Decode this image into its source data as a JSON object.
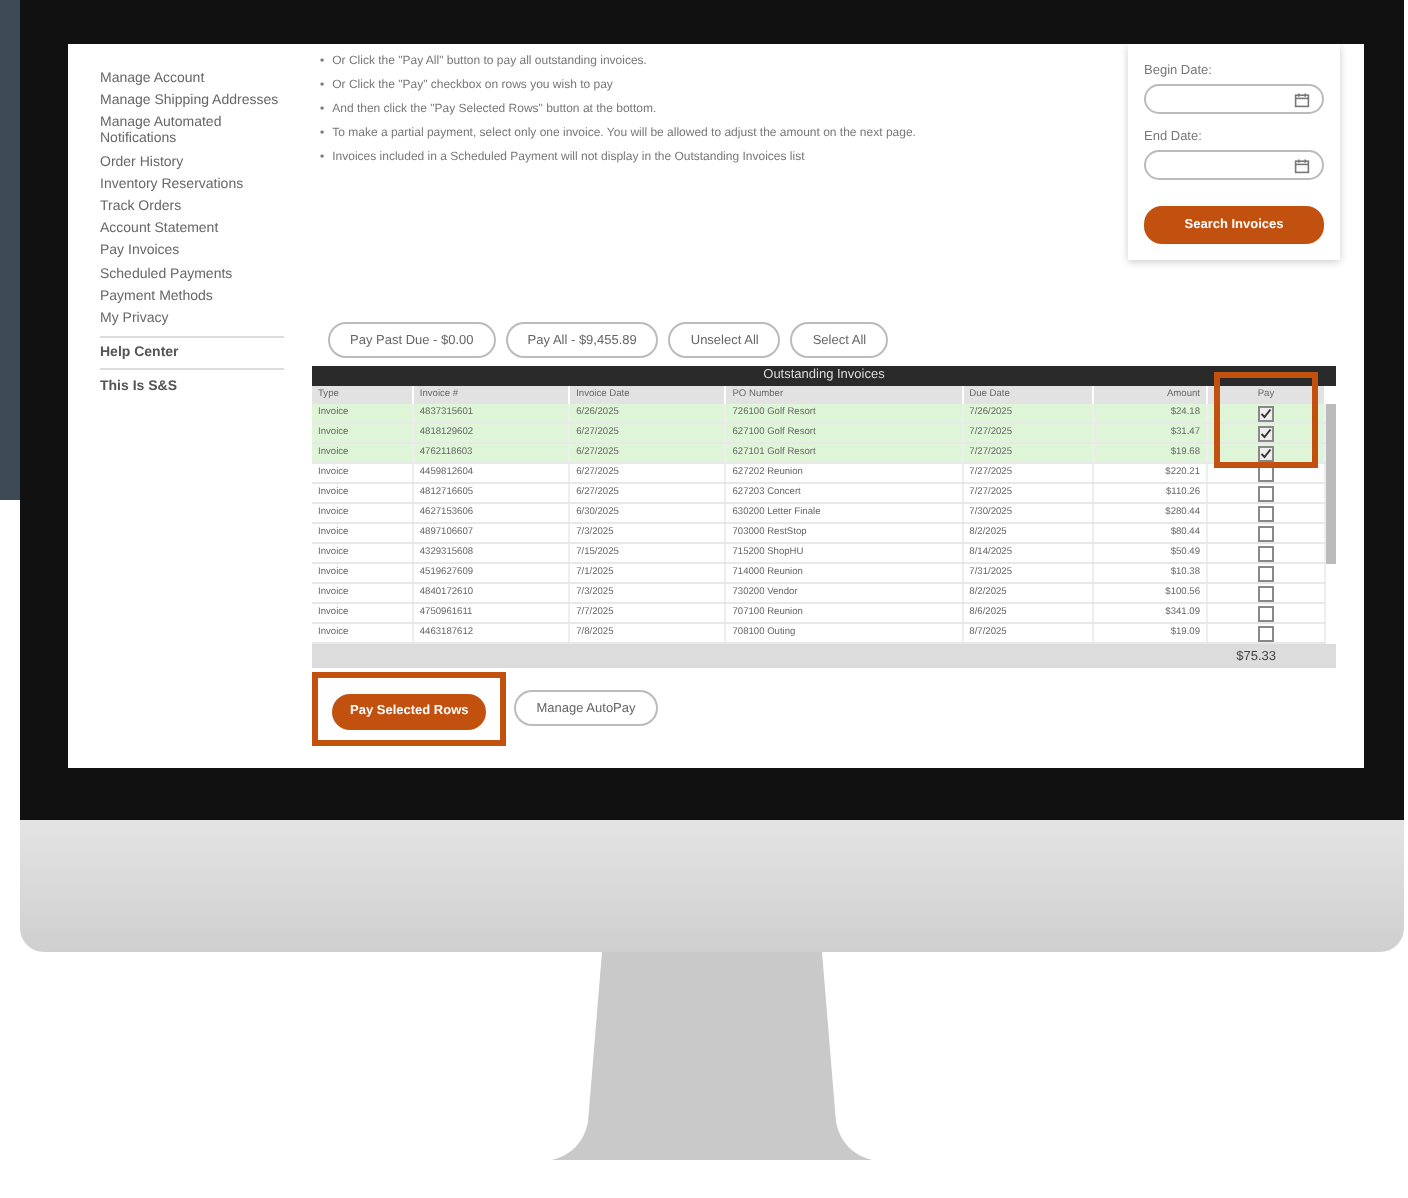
{
  "sidebar": {
    "items": [
      {
        "label": "Manage Account"
      },
      {
        "label": "Manage Shipping Addresses"
      },
      {
        "label": "Manage Automated Notifications"
      },
      {
        "label": "Order History"
      },
      {
        "label": "Inventory Reservations"
      },
      {
        "label": "Track Orders"
      },
      {
        "label": "Account Statement"
      },
      {
        "label": "Pay Invoices"
      },
      {
        "label": "Scheduled Payments"
      },
      {
        "label": "Payment Methods"
      },
      {
        "label": "My Privacy"
      }
    ],
    "sections": [
      "Help Center",
      "This Is S&S"
    ]
  },
  "instructions": [
    {
      "bullet": "•",
      "text": "Or Click the \"Pay All\" button to pay all outstanding invoices."
    },
    {
      "bullet": "•",
      "text": "Or Click the \"Pay\" checkbox on rows you wish to pay"
    },
    {
      "bullet": "•",
      "text": "And then click the \"Pay Selected Rows\" button at the bottom."
    },
    {
      "bullet": "•",
      "text": "To make a partial payment, select only one invoice. You will be allowed to adjust the amount on the next page."
    },
    {
      "bullet": "•",
      "text": "Invoices included in a Scheduled Payment will not display in the Outstanding Invoices list"
    }
  ],
  "search": {
    "fields": [
      {
        "label": "Begin Date:"
      },
      {
        "label": "End Date:"
      }
    ],
    "button": "Search Invoices"
  },
  "actions": [
    "Pay Past Due - $0.00",
    "Pay All - $9,455.89",
    "Unselect All",
    "Select All"
  ],
  "table": {
    "title": "Outstanding Invoices",
    "columns": [
      "Type",
      "Invoice #",
      "Invoice Date",
      "PO Number",
      "Due Date",
      "Amount",
      "Pay"
    ],
    "rows": [
      {
        "cells": [
          "Invoice",
          "4837315601",
          "6/26/2025",
          "726100 Golf Resort",
          "7/26/2025",
          "$24.18"
        ],
        "checked": true
      },
      {
        "cells": [
          "Invoice",
          "4818129602",
          "6/27/2025",
          "627100 Golf Resort",
          "7/27/2025",
          "$31.47"
        ],
        "checked": true
      },
      {
        "cells": [
          "Invoice",
          "4762118603",
          "6/27/2025",
          "627101 Golf Resort",
          "7/27/2025",
          "$19.68"
        ],
        "checked": true
      },
      {
        "cells": [
          "Invoice",
          "4459812604",
          "6/27/2025",
          "627202 Reunion",
          "7/27/2025",
          "$220.21"
        ],
        "checked": false
      },
      {
        "cells": [
          "Invoice",
          "4812716605",
          "6/27/2025",
          "627203 Concert",
          "7/27/2025",
          "$110.26"
        ],
        "checked": false
      },
      {
        "cells": [
          "Invoice",
          "4627153606",
          "6/30/2025",
          "630200 Letter Finale",
          "7/30/2025",
          "$280.44"
        ],
        "checked": false
      },
      {
        "cells": [
          "Invoice",
          "4897106607",
          "7/3/2025",
          "703000 RestStop",
          "8/2/2025",
          "$80.44"
        ],
        "checked": false
      },
      {
        "cells": [
          "Invoice",
          "4329315608",
          "7/15/2025",
          "715200 ShopHU",
          "8/14/2025",
          "$50.49"
        ],
        "checked": false
      },
      {
        "cells": [
          "Invoice",
          "4519627609",
          "7/1/2025",
          "714000 Reunion",
          "7/31/2025",
          "$10.38"
        ],
        "checked": false
      },
      {
        "cells": [
          "Invoice",
          "4840172610",
          "7/3/2025",
          "730200 Vendor",
          "8/2/2025",
          "$100.56"
        ],
        "checked": false
      },
      {
        "cells": [
          "Invoice",
          "4750961611",
          "7/7/2025",
          "707100 Reunion",
          "8/6/2025",
          "$341.09"
        ],
        "checked": false
      },
      {
        "cells": [
          "Invoice",
          "4463187612",
          "7/8/2025",
          "708100 Outing",
          "8/7/2025",
          "$19.09"
        ],
        "checked": false
      }
    ],
    "total": "$75.33"
  },
  "bottom_buttons": [
    {
      "label": "Pay Selected Rows",
      "kind": "primary"
    },
    {
      "label": "Manage AutoPay",
      "kind": "secondary"
    }
  ]
}
